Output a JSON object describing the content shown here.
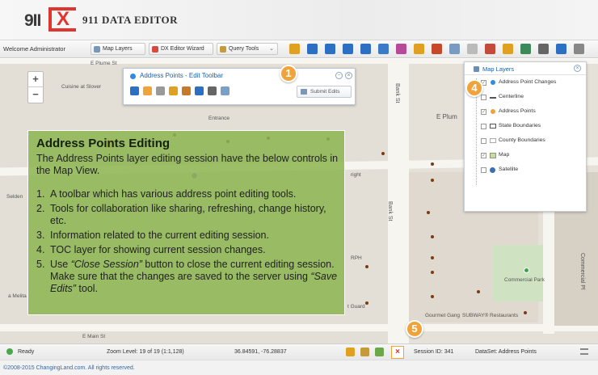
{
  "header": {
    "logo_911": "9II",
    "logo_dx": "X",
    "title": "911 DATA EDITOR"
  },
  "toolbar": {
    "welcome": "Welcome Administrator",
    "map_layers": "Map Layers",
    "dx_editor_wizard": "DX Editor Wizard",
    "query_tools": "Query Tools",
    "tool_icons": [
      "layer-icon",
      "zoom-in-icon",
      "zoom-out-icon",
      "zoom-prev-icon",
      "zoom-next-icon",
      "full-extent-icon",
      "measure-icon",
      "draw-icon",
      "text-icon",
      "select-icon",
      "clear-icon",
      "identify-icon",
      "edit-icon",
      "locate-icon",
      "print-icon",
      "info-icon",
      "menu-icon"
    ]
  },
  "map": {
    "labels": {
      "cuisine": "Cuisine at Slover",
      "e_plume_top": "E Plume St",
      "bank_st_top": "Bank St",
      "e_plume_right": "E Plum",
      "bank_st_mid": "Bank St",
      "commercial_park": "Commercial Park",
      "commercial_pl": "Commercial Pl",
      "gourmet": "Gourmet Gang",
      "subway": "SUBWAY® Restaurants",
      "e_main": "E Main St",
      "selden": "Selden",
      "melita": "a Melita",
      "entrance": "Entrance",
      "right": "right",
      "rph": "RPH",
      "guard": "t Guard"
    }
  },
  "edit_toolbar": {
    "title": "Address Points - Edit Toolbar",
    "submit": "Submit Edits"
  },
  "layers_panel": {
    "title": "Map Layers",
    "items": [
      {
        "label": "Address Point Changes",
        "checked": true
      },
      {
        "label": "Centerline",
        "checked": false
      },
      {
        "label": "Address Points",
        "checked": true
      },
      {
        "label": "State Boundaries",
        "checked": false
      },
      {
        "label": "County Boundaries",
        "checked": false
      },
      {
        "label": "Map",
        "checked": true
      },
      {
        "label": "Satellite",
        "checked": false
      }
    ]
  },
  "info": {
    "title": "Address Points Editing",
    "intro": "The Address Points layer editing session have the below controls in the Map View.",
    "items": [
      {
        "num": "1.",
        "text": "A toolbar which has various address point editing tools."
      },
      {
        "num": "2.",
        "text": "Tools for collaboration like sharing, refreshing, change history, etc."
      },
      {
        "num": "3.",
        "text": "Information related to the current editing session."
      },
      {
        "num": "4.",
        "text": "TOC layer for showing current session changes."
      },
      {
        "num": "5.",
        "text_a": "Use ",
        "em_a": "“Close Session”",
        "text_b": " button to close the current editing session. Make sure that the changes are saved to the server using ",
        "em_b": "“Save Edits”",
        "text_c": " tool."
      }
    ]
  },
  "callouts": [
    "1",
    "2",
    "3",
    "4",
    "5"
  ],
  "status": {
    "ready": "Ready",
    "zoom": "Zoom Level: 19 of 19 (1:1,128)",
    "coords": "36.84591, -76.28837",
    "session": "Session ID: 341",
    "dataset": "DataSet: Address Points"
  },
  "footer": {
    "copyright": "©2008-2015 ChangingLand.com. All rights reserved."
  },
  "colors": {
    "accent": "#f0a33a",
    "brand_red": "#e0342f",
    "info_green": "#8cb450",
    "link_blue": "#1a5fa8"
  }
}
